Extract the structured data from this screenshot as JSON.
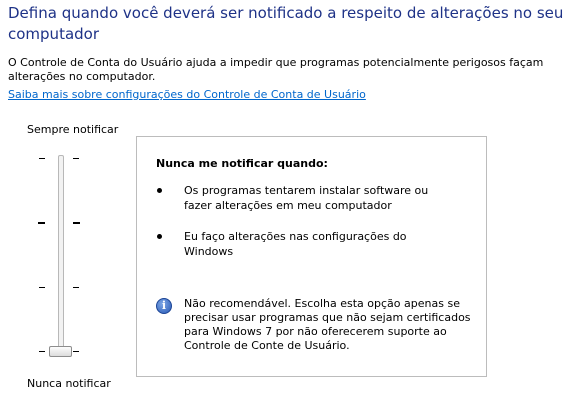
{
  "page": {
    "title": "Defina quando você deverá ser notificado a respeito de alterações no seu computador",
    "description": "O Controle de Conta do Usuário ajuda a impedir que programas potencialmente perigosos façam alterações no computador.",
    "learn_more_link": "Saiba mais sobre configurações do Controle de Conta de Usuário"
  },
  "slider": {
    "top_label": "Sempre notificar",
    "bottom_label": "Nunca notificar",
    "levels": 4,
    "selected_level": 1
  },
  "info_box": {
    "heading": "Nunca me notificar quando:",
    "bullets": [
      "Os programas tentarem instalar software ou fazer alterações em meu computador",
      "Eu faço alterações nas configurações do Windows"
    ],
    "note_icon": "info-icon",
    "note": "Não recomendável. Escolha esta opção apenas se precisar usar programas que não sejam certificados para Windows 7 por não oferecerem suporte ao Controle de Conte de Usuário."
  },
  "colors": {
    "title": "#1e3287",
    "link": "#0066cc",
    "box_border": "#bcbcbc"
  }
}
